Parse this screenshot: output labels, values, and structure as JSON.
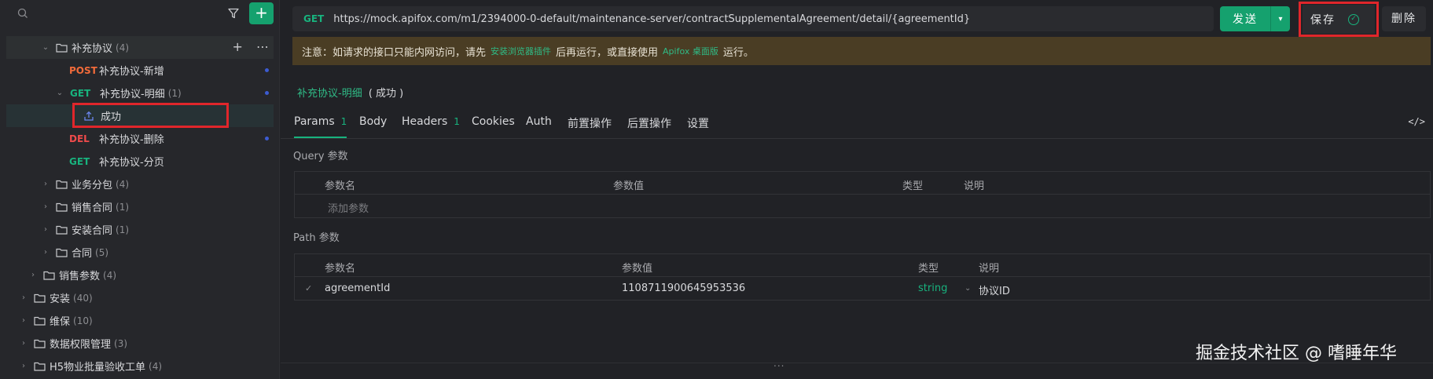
{
  "sidebar": {
    "tree": [
      {
        "kind": "folder",
        "label": "补充协议",
        "count": "(4)",
        "expanded": true
      },
      {
        "kind": "api",
        "method": "POST",
        "label": "补充协议-新增"
      },
      {
        "kind": "api",
        "method": "GET",
        "label": "补充协议-明细",
        "count": "(1)",
        "expanded": true
      },
      {
        "kind": "case",
        "label": "成功"
      },
      {
        "kind": "api",
        "method": "DEL",
        "label": "补充协议-删除"
      },
      {
        "kind": "api",
        "method": "GET",
        "label": "补充协议-分页"
      },
      {
        "kind": "folder",
        "label": "业务分包",
        "count": "(4)"
      },
      {
        "kind": "folder",
        "label": "销售合同",
        "count": "(1)"
      },
      {
        "kind": "folder",
        "label": "安装合同",
        "count": "(1)"
      },
      {
        "kind": "folder",
        "label": "合同",
        "count": "(5)"
      },
      {
        "kind": "folder",
        "label": "销售参数",
        "count": "(4)"
      },
      {
        "kind": "folder",
        "label": "安装",
        "count": "(40)"
      },
      {
        "kind": "folder",
        "label": "维保",
        "count": "(10)"
      },
      {
        "kind": "folder",
        "label": "数据权限管理",
        "count": "(3)"
      },
      {
        "kind": "folder",
        "label": "H5物业批量验收工单",
        "count": "(4)"
      }
    ],
    "add_icon": "+"
  },
  "request": {
    "method": "GET",
    "url": "https://mock.apifox.com/m1/2394000-0-default/maintenance-server/contractSupplementalAgreement/detail/{agreementId}",
    "send_label": "发送",
    "save_label": "保存",
    "delete_label": "删除"
  },
  "notice": {
    "prefix": "注意：如请求的接口只能内网访问，请先",
    "link1": "安装浏览器插件",
    "middle": "后再运行，或直接使用",
    "link2": "Apifox 桌面版",
    "suffix": "运行。"
  },
  "breadcrumb": {
    "link": "补充协议-明细",
    "status": "( 成功 )"
  },
  "tabs": [
    {
      "label": "Params",
      "badge": "1"
    },
    {
      "label": "Body",
      "badge": ""
    },
    {
      "label": "Headers",
      "badge": "1"
    },
    {
      "label": "Cookies",
      "badge": ""
    },
    {
      "label": "Auth",
      "badge": ""
    },
    {
      "label": "前置操作",
      "badge": ""
    },
    {
      "label": "后置操作",
      "badge": ""
    },
    {
      "label": "设置",
      "badge": ""
    }
  ],
  "code_icon": "</>",
  "query": {
    "title": "Query 参数",
    "headers": [
      "参数名",
      "参数值",
      "类型",
      "说明"
    ],
    "add_placeholder": "添加参数"
  },
  "path": {
    "title": "Path 参数",
    "headers": [
      "参数名",
      "参数值",
      "类型",
      "说明"
    ],
    "rows": [
      {
        "name": "agreementId",
        "value": "1108711900645953536",
        "type": "string",
        "desc": "协议ID"
      }
    ]
  },
  "footer": {
    "dots": "...",
    "watermark": "掘金技术社区 @ 嗜睡年华"
  },
  "colors": {
    "accent": "#15a16e",
    "post": "#f26b3a",
    "get": "#18b37e",
    "del": "#ef4b4b",
    "highlight_box": "#e0262b"
  }
}
